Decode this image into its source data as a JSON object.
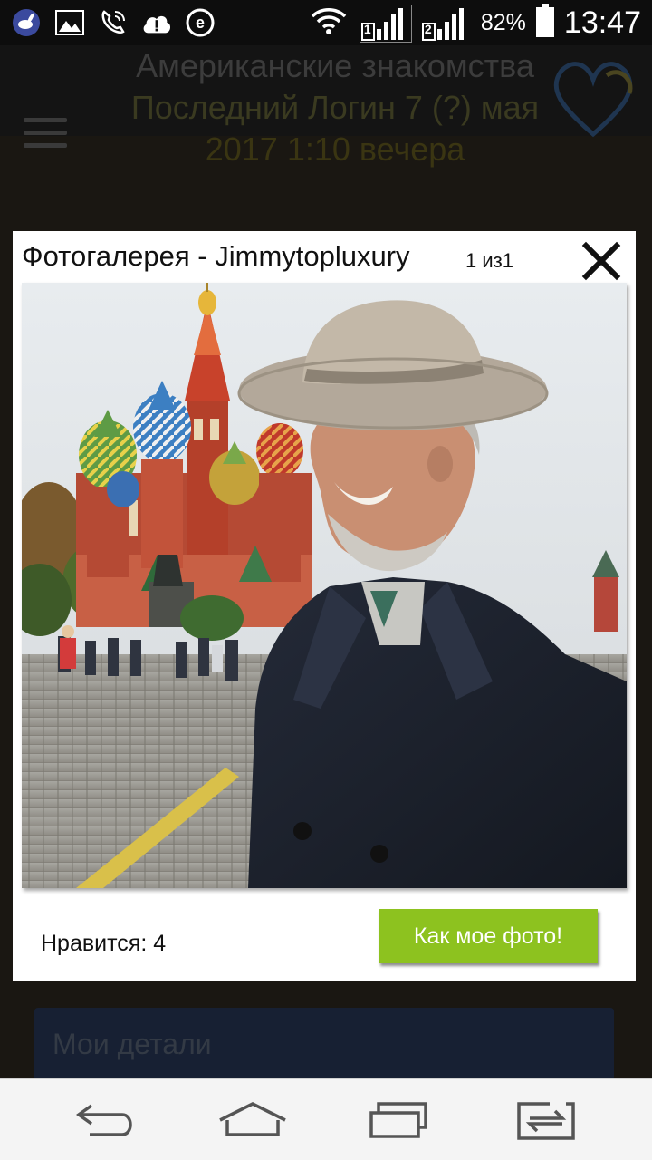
{
  "status_bar": {
    "time": "13:47",
    "battery_percent": "82%",
    "sim1_label": "1",
    "sim2_label": "2",
    "left_icons": [
      "rabbit-app-icon",
      "image-icon",
      "wifi-call-icon",
      "cloud-alert-icon",
      "e-app-icon"
    ]
  },
  "background_page": {
    "title_line1": "Американские знакомства",
    "title_line2": "Последний Логин 7 (?) мая",
    "title_line3": "2017 1:10 вечера",
    "details_label": "Мои детали"
  },
  "gallery": {
    "title": "Фотогалерея - Jimmytopluxury",
    "counter": "1 из1",
    "likes_text": "Нравится: 4",
    "like_button_label": "Как мое фото!",
    "accent_color": "#8dc21f"
  },
  "nav_bar": {
    "buttons": [
      "back-icon",
      "home-icon",
      "recent-apps-icon",
      "dual-window-icon"
    ]
  }
}
